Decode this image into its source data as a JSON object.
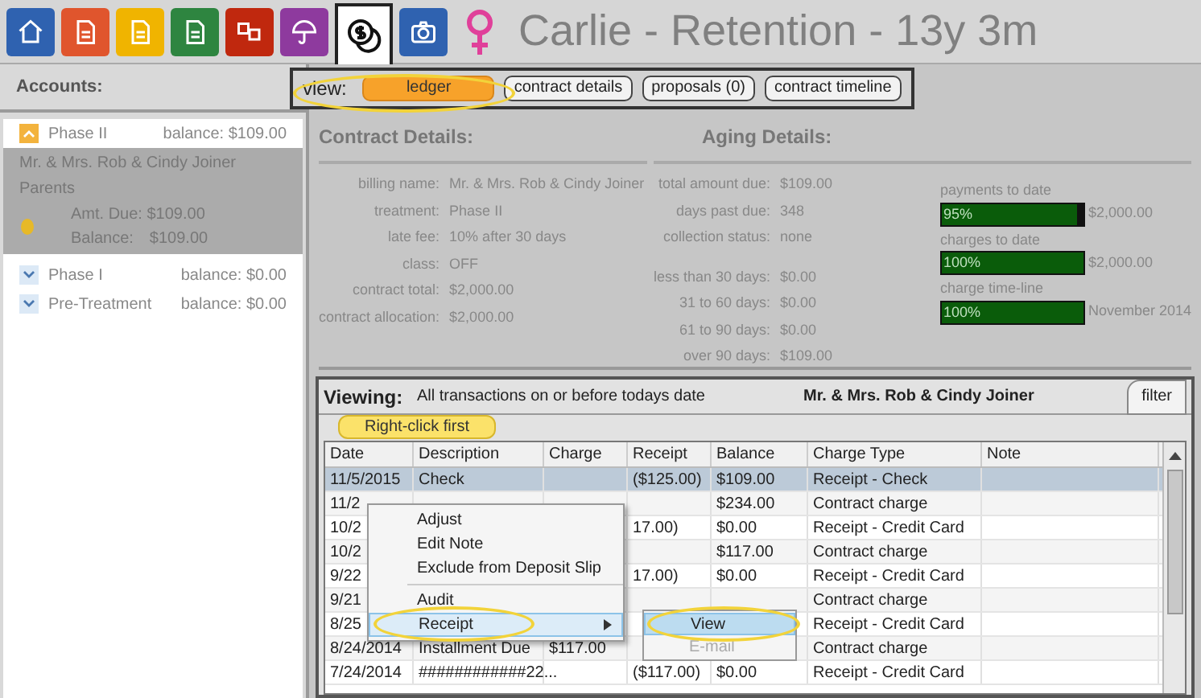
{
  "nav_icons": [
    {
      "kind": "home",
      "color": "#2f62b0",
      "selected": false
    },
    {
      "kind": "document",
      "color": "#e0552d",
      "selected": false
    },
    {
      "kind": "document",
      "color": "#f0b400",
      "selected": false
    },
    {
      "kind": "document",
      "color": "#2e8540",
      "selected": false
    },
    {
      "kind": "cubes",
      "color": "#c0280e",
      "selected": false
    },
    {
      "kind": "umbrella",
      "color": "#8e3a9e",
      "selected": false
    },
    {
      "kind": "coins",
      "color": "#ffffff",
      "selected": true
    },
    {
      "kind": "camera",
      "color": "#2f62b0",
      "selected": false
    }
  ],
  "patient": {
    "title": "Carlie - Retention - 13y 3m"
  },
  "view_bar": {
    "label": "view:",
    "buttons": [
      {
        "label": "ledger",
        "selected": true
      },
      {
        "label": "contract details",
        "selected": false
      },
      {
        "label": "proposals (0)",
        "selected": false
      },
      {
        "label": "contract timeline",
        "selected": false
      }
    ]
  },
  "accounts": {
    "title": "Accounts:",
    "items": [
      {
        "name": "Phase II",
        "balance": "balance: $109.00",
        "expanded": true,
        "details": {
          "responsible": "Mr. & Mrs. Rob & Cindy Joiner",
          "relation": "Parents",
          "amount_due": "Amt. Due: $109.00",
          "balance_label": "Balance:",
          "balance": "$109.00"
        }
      },
      {
        "name": "Phase I",
        "balance": "balance: $0.00",
        "expanded": false
      },
      {
        "name": "Pre-Treatment",
        "balance": "balance: $0.00",
        "expanded": false
      }
    ]
  },
  "contract_details": {
    "title": "Contract Details:",
    "fields": [
      {
        "label": "billing name:",
        "value": "Mr. & Mrs. Rob & Cindy Joiner"
      },
      {
        "label": "treatment:",
        "value": "Phase II"
      },
      {
        "label": "late fee:",
        "value": "10% after 30 days"
      },
      {
        "label": "class:",
        "value": "OFF"
      },
      {
        "label": "contract total:",
        "value": "$2,000.00"
      },
      {
        "label": "contract allocation:",
        "value": "$2,000.00"
      }
    ]
  },
  "aging_details": {
    "title": "Aging Details:",
    "fields": [
      {
        "label": "total amount due:",
        "value": "$109.00"
      },
      {
        "label": "days past due:",
        "value": "348"
      },
      {
        "label": "collection status:",
        "value": "none"
      },
      {
        "label": "less than 30 days:",
        "value": "$0.00"
      },
      {
        "label": "31 to 60 days:",
        "value": "$0.00"
      },
      {
        "label": "61 to 90 days:",
        "value": "$0.00"
      },
      {
        "label": "over 90 days:",
        "value": "$109.00"
      }
    ],
    "progress": [
      {
        "label": "payments to date",
        "percent": "95%",
        "level": 0.95,
        "value": "$2,000.00"
      },
      {
        "label": "charges to date",
        "percent": "100%",
        "level": 1,
        "value": "$2,000.00"
      },
      {
        "label": "charge time-line",
        "percent": "100%",
        "level": 1,
        "value": "November 2014"
      }
    ]
  },
  "ledger": {
    "viewing_label": "Viewing:",
    "viewing_text": "All transactions on or before todays date",
    "account_name": "Mr. & Mrs. Rob & Cindy Joiner",
    "filter": "filter",
    "columns": [
      "Date",
      "Description",
      "Charge",
      "Receipt",
      "Balance",
      "Charge Type",
      "Note"
    ],
    "rows": [
      {
        "selected": true,
        "cells": [
          "11/5/2015",
          "Check",
          "",
          "($125.00)",
          "$109.00",
          "Receipt - Check",
          ""
        ]
      },
      {
        "selected": false,
        "cells": [
          "11/2",
          "",
          "",
          "",
          "$234.00",
          "Contract charge",
          ""
        ]
      },
      {
        "selected": false,
        "cells": [
          "10/2",
          "",
          "",
          "17.00)",
          "$0.00",
          "Receipt - Credit Card",
          ""
        ]
      },
      {
        "selected": false,
        "cells": [
          "10/2",
          "",
          "",
          "",
          "$117.00",
          "Contract charge",
          ""
        ]
      },
      {
        "selected": false,
        "cells": [
          "9/22",
          "",
          "",
          "17.00)",
          "$0.00",
          "Receipt - Credit Card",
          ""
        ]
      },
      {
        "selected": false,
        "cells": [
          "9/21",
          "",
          "",
          "",
          "",
          "Contract charge",
          ""
        ]
      },
      {
        "selected": false,
        "cells": [
          "8/25",
          "",
          "",
          "",
          "",
          "Receipt - Credit Card",
          ""
        ]
      },
      {
        "selected": false,
        "cells": [
          "8/24/2014",
          "Installment Due",
          "$117.00",
          "",
          "",
          "Contract charge",
          ""
        ]
      },
      {
        "selected": false,
        "cells": [
          "7/24/2014",
          "############22...",
          "",
          "($117.00)",
          "$0.00",
          "Receipt - Credit Card",
          ""
        ]
      }
    ]
  },
  "context_menu": {
    "items": [
      {
        "label": "Adjust",
        "has_submenu": false,
        "highlighted": false
      },
      {
        "label": "Edit Note",
        "has_submenu": false,
        "highlighted": false
      },
      {
        "label": "Exclude from Deposit Slip",
        "has_submenu": false,
        "highlighted": false
      },
      {
        "label": "Audit",
        "has_submenu": false,
        "highlighted": false,
        "separator_before": true
      },
      {
        "label": "Receipt",
        "has_submenu": true,
        "highlighted": true
      }
    ],
    "submenu": [
      {
        "label": "View",
        "disabled": false,
        "highlighted": true
      },
      {
        "label": "E-mail",
        "disabled": true,
        "highlighted": false
      }
    ]
  },
  "callout": {
    "text": "Right-click first"
  }
}
